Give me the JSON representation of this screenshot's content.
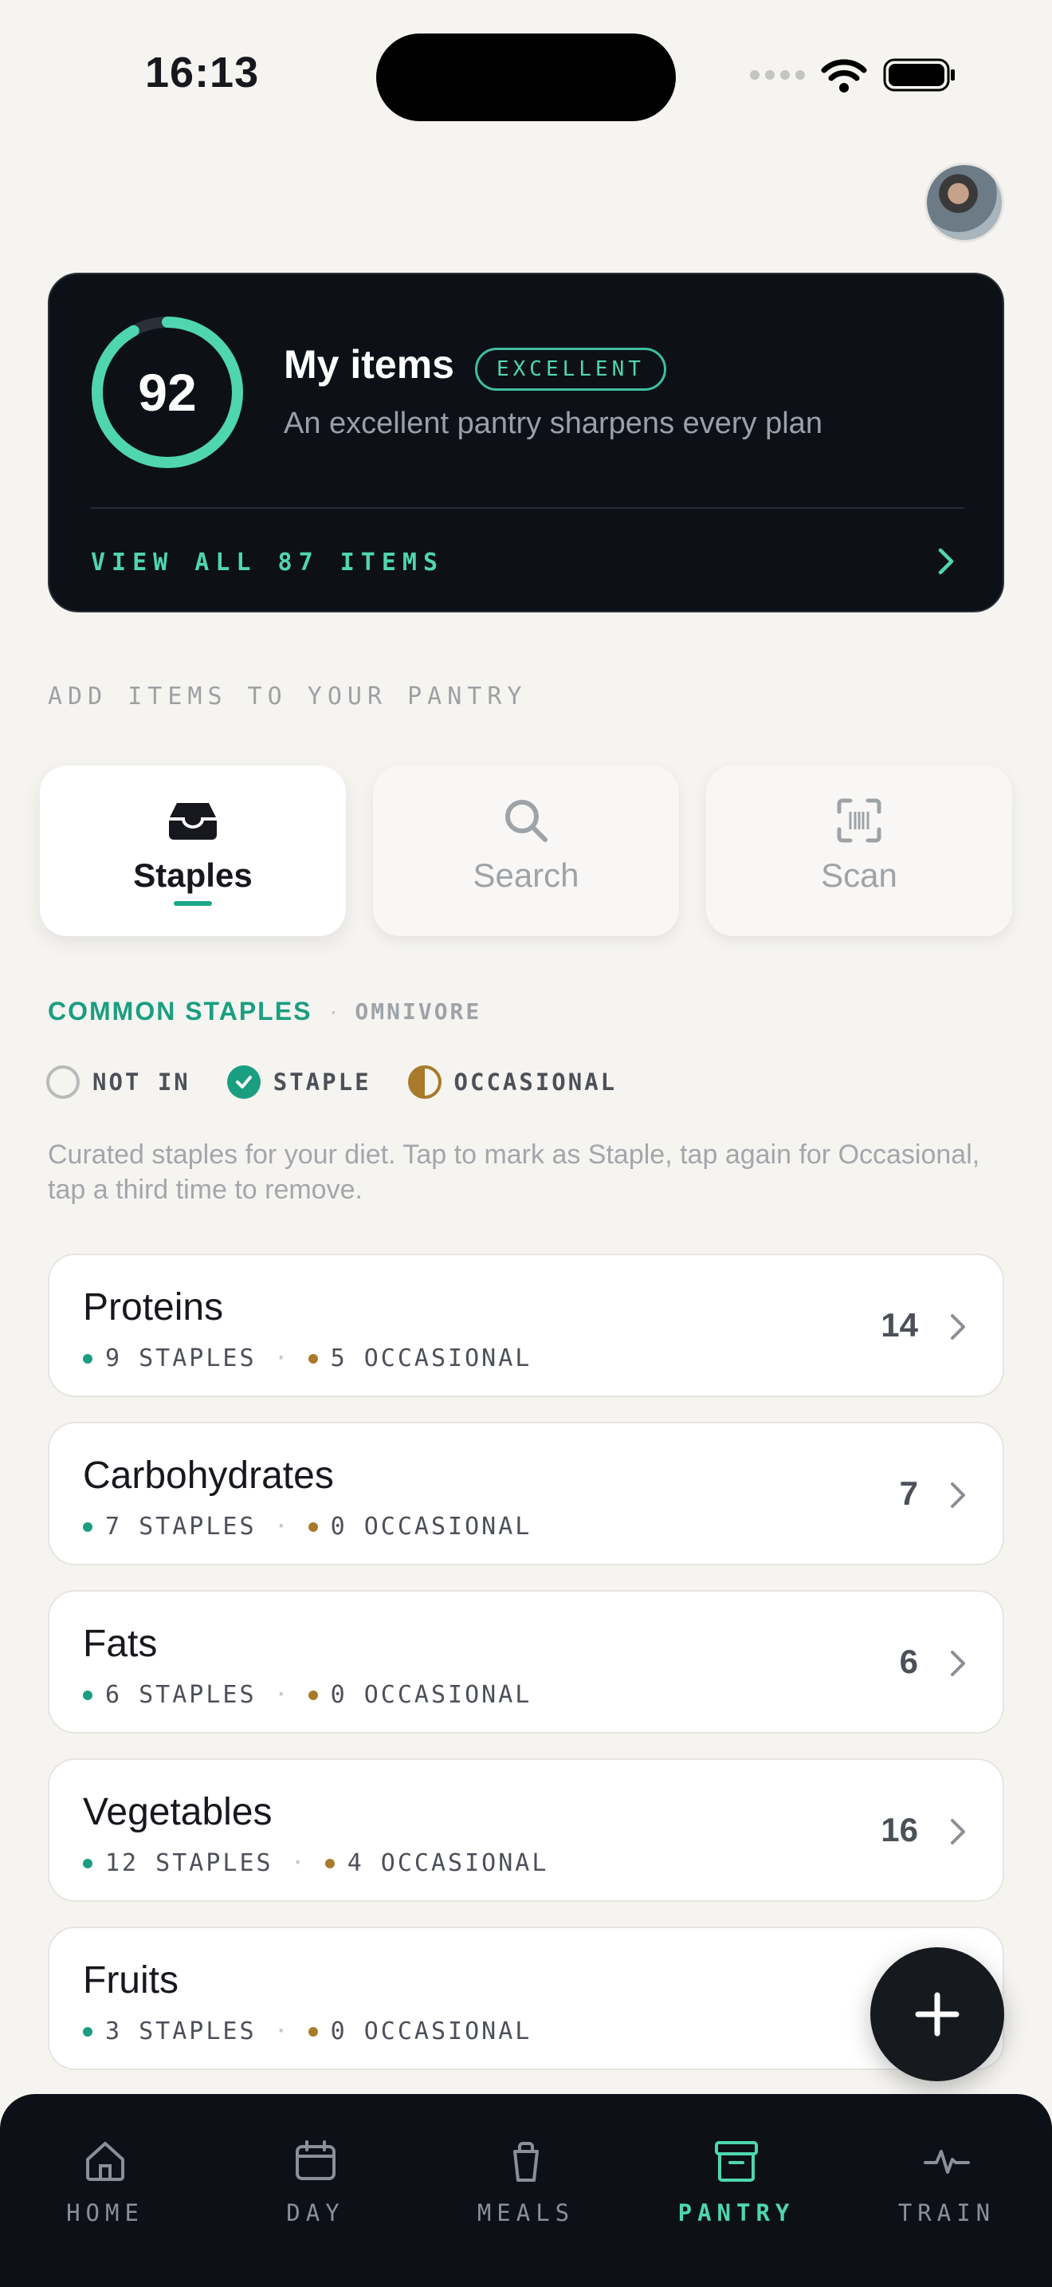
{
  "status_bar": {
    "time": "16:13"
  },
  "score_card": {
    "score": "92",
    "score_fraction": 0.92,
    "title": "My items",
    "badge": "EXCELLENT",
    "subtitle": "An excellent pantry sharpens every plan",
    "view_all": "VIEW ALL 87 ITEMS"
  },
  "section_label": "ADD ITEMS TO YOUR PANTRY",
  "tabs": [
    {
      "label": "Staples",
      "icon": "inbox-icon",
      "active": true
    },
    {
      "label": "Search",
      "icon": "search-icon",
      "active": false
    },
    {
      "label": "Scan",
      "icon": "barcode-scan-icon",
      "active": false
    }
  ],
  "common_staples": {
    "title": "COMMON STAPLES",
    "diet": "OMNIVORE"
  },
  "legend": {
    "not_in": "NOT IN",
    "staple": "STAPLE",
    "occasional": "OCCASIONAL"
  },
  "help_text": "Curated staples for your diet. Tap to mark as Staple, tap again for Occasional, tap a third time to remove.",
  "categories": [
    {
      "name": "Proteins",
      "staples": "9 STAPLES",
      "occasional": "5 OCCASIONAL",
      "count": "14"
    },
    {
      "name": "Carbohydrates",
      "staples": "7 STAPLES",
      "occasional": "0 OCCASIONAL",
      "count": "7"
    },
    {
      "name": "Fats",
      "staples": "6 STAPLES",
      "occasional": "0 OCCASIONAL",
      "count": "6"
    },
    {
      "name": "Vegetables",
      "staples": "12 STAPLES",
      "occasional": "4 OCCASIONAL",
      "count": "16"
    },
    {
      "name": "Fruits",
      "staples": "3 STAPLES",
      "occasional": "0 OCCASIONAL",
      "count": ""
    }
  ],
  "nav": [
    {
      "label": "HOME",
      "icon": "home-icon",
      "active": false
    },
    {
      "label": "DAY",
      "icon": "calendar-icon",
      "active": false
    },
    {
      "label": "MEALS",
      "icon": "cup-icon",
      "active": false
    },
    {
      "label": "PANTRY",
      "icon": "archive-box-icon",
      "active": true
    },
    {
      "label": "TRAIN",
      "icon": "pulse-icon",
      "active": false
    }
  ],
  "colors": {
    "accent": "#1a9e80",
    "accent_light": "#4fd6b0",
    "occasional": "#a87a2a",
    "dark": "#0d1117"
  }
}
